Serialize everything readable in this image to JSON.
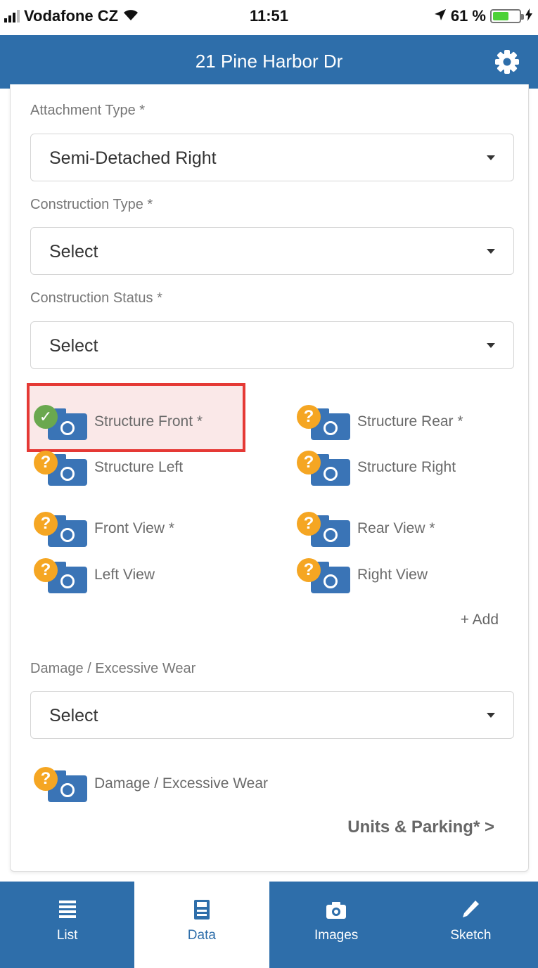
{
  "status_bar": {
    "carrier": "Vodafone CZ",
    "time": "11:51",
    "battery_text": "61 %",
    "battery_level": 0.61
  },
  "header": {
    "title": "21 Pine Harbor Dr",
    "settings_icon": "gear-icon"
  },
  "form": {
    "attachment_type": {
      "label": "Attachment Type *",
      "value": "Semi-Detached Right"
    },
    "construction_type": {
      "label": "Construction Type *",
      "value": "Select"
    },
    "construction_status": {
      "label": "Construction Status *",
      "value": "Select"
    },
    "photos": [
      {
        "label": "Structure Front *",
        "status": "complete"
      },
      {
        "label": "Structure Rear *",
        "status": "missing"
      },
      {
        "label": "Structure Left",
        "status": "missing"
      },
      {
        "label": "Structure Right",
        "status": "missing"
      },
      {
        "label": "Front View *",
        "status": "missing"
      },
      {
        "label": "Rear View *",
        "status": "missing"
      },
      {
        "label": "Left View",
        "status": "missing"
      },
      {
        "label": "Right View",
        "status": "missing"
      }
    ],
    "add_label": "+ Add",
    "damage": {
      "label": "Damage / Excessive Wear",
      "value": "Select"
    },
    "damage_photo": {
      "label": "Damage / Excessive Wear",
      "status": "missing"
    },
    "next_link": "Units & Parking* >"
  },
  "badges": {
    "missing_symbol": "?",
    "complete_symbol": "✓"
  },
  "tabs": [
    {
      "label": "List",
      "icon": "list-icon"
    },
    {
      "label": "Data",
      "icon": "save-icon",
      "active": true
    },
    {
      "label": "Images",
      "icon": "camera-icon"
    },
    {
      "label": "Sketch",
      "icon": "pencil-icon"
    }
  ],
  "colors": {
    "primary": "#2e6eaa",
    "badge_missing": "#f5a623",
    "badge_complete": "#6aa84f",
    "highlight": "#e53935"
  }
}
